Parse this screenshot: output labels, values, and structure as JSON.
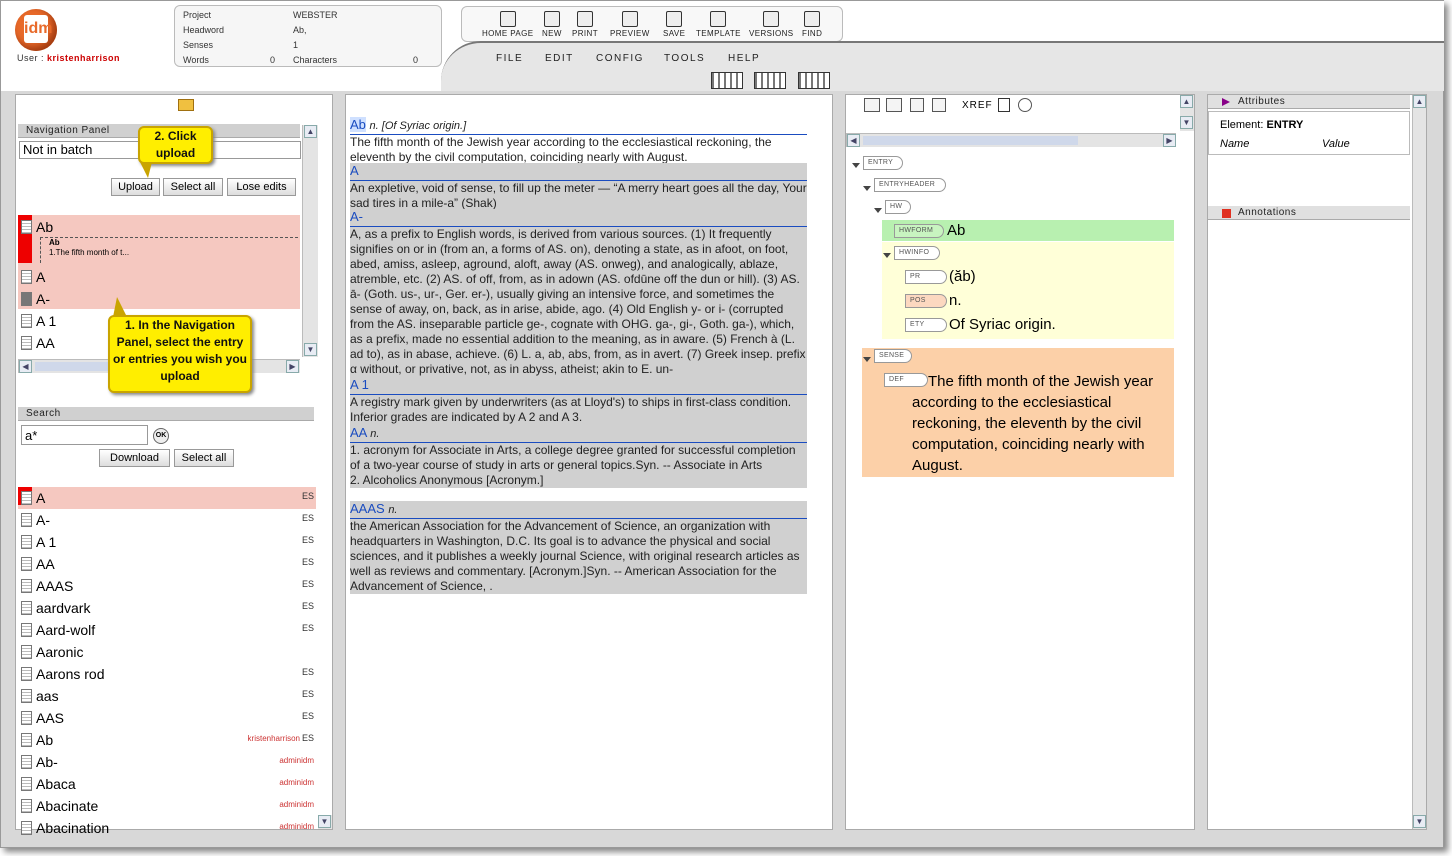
{
  "header": {
    "user_label": "User :",
    "user_name": "kristenharrison",
    "project_label": "Project",
    "project_value": "WEBSTER",
    "headword_label": "Headword",
    "headword_value": "Ab,",
    "senses_label": "Senses",
    "senses_value": "1",
    "words_label": "Words",
    "words_value": "0",
    "characters_label": "Characters",
    "characters_value": "0"
  },
  "toolbar": [
    "HOME PAGE",
    "NEW",
    "PRINT",
    "PREVIEW",
    "SAVE",
    "TEMPLATE",
    "VERSIONS",
    "FIND"
  ],
  "menu": [
    "FILE",
    "EDIT",
    "CONFIG",
    "TOOLS",
    "HELP"
  ],
  "nav": {
    "title": "Navigation Panel",
    "batch_value": "Not in batch",
    "upload": "Upload",
    "select_all": "Select all",
    "lose_edits": "Lose edits",
    "items": [
      "Ab",
      "A",
      "A-",
      "A 1",
      "AA"
    ],
    "sub_hw": "Ab",
    "sub_def": "1.The fifth month of t..."
  },
  "callouts": {
    "upload": "2. Click upload",
    "nav": "1. In the Navigation Panel, select the entry or entries you wish you upload"
  },
  "search": {
    "title": "Search",
    "query": "a*",
    "ok": "OK",
    "download": "Download",
    "select_all": "Select all",
    "results": [
      {
        "w": "A",
        "es": "ES",
        "who": ""
      },
      {
        "w": "A-",
        "es": "ES",
        "who": ""
      },
      {
        "w": "A 1",
        "es": "ES",
        "who": ""
      },
      {
        "w": "AA",
        "es": "ES",
        "who": ""
      },
      {
        "w": "AAAS",
        "es": "ES",
        "who": ""
      },
      {
        "w": "aardvark",
        "es": "ES",
        "who": ""
      },
      {
        "w": "Aard-wolf",
        "es": "ES",
        "who": ""
      },
      {
        "w": "Aaronic",
        "es": "",
        "who": ""
      },
      {
        "w": "Aarons rod",
        "es": "ES",
        "who": ""
      },
      {
        "w": "aas",
        "es": "ES",
        "who": ""
      },
      {
        "w": "AAS",
        "es": "ES",
        "who": ""
      },
      {
        "w": "Ab",
        "es": "ES",
        "who": "kristenharrison"
      },
      {
        "w": "Ab-",
        "es": "",
        "who": "adminidm"
      },
      {
        "w": "Abaca",
        "es": "",
        "who": "adminidm"
      },
      {
        "w": "Abacinate",
        "es": "",
        "who": "adminidm"
      },
      {
        "w": "Abacination",
        "es": "",
        "who": "adminidm"
      }
    ]
  },
  "entries": [
    {
      "hw": "Ab",
      "meta": "n. [Of Syriac origin.]",
      "body": "The fifth month of the Jewish year according to the ecclesiastical reckoning, the eleventh by the civil computation, coinciding nearly with August."
    },
    {
      "hw": "A",
      "meta": "",
      "body": "An expletive, void of sense, to fill up the meter — “A merry heart goes all the day, Your sad tires in a mile-a” (Shak)"
    },
    {
      "hw": "A-",
      "meta": "",
      "body": "A, as a prefix to English words, is derived from various sources. (1) It frequently signifies on or in (from an, a forms of AS. on), denoting a state, as in afoot, on foot, abed, amiss, asleep, aground, aloft, away (AS. onweg), and analogically, ablaze, atremble, etc. (2) AS. of off, from, as in adown (AS. ofdūne off the dun or hill). (3) AS. ā- (Goth. us-, ur-, Ger. er-), usually giving an intensive force, and sometimes the sense of away, on, back, as in arise, abide, ago. (4) Old English y- or i- (corrupted from the AS. inseparable particle ge-, cognate with OHG. ga-, gi-, Goth. ga-), which, as a prefix, made no essential addition to the meaning, as in aware. (5) French à (L. ad to), as in abase, achieve. (6) L. a, ab, abs, from, as in avert. (7) Greek insep. prefix α without, or privative, not, as in abyss, atheist; akin to E. un-"
    },
    {
      "hw": "A 1",
      "meta": "",
      "body": "A registry mark given by underwriters (as at Lloyd's) to ships in first-class condition. Inferior grades are indicated by A 2 and A 3."
    },
    {
      "hw": "AA",
      "meta": "n.",
      "body": "1. acronym for Associate in Arts, a college degree granted for successful completion of a two-year course of study in arts or general topics.Syn. -- Associate in Arts\n2. Alcoholics Anonymous [Acronym.]"
    },
    {
      "hw": "AAAS",
      "meta": "n.",
      "body": "the American Association for the Advancement of Science, an organization with headquarters in Washington, D.C. Its goal is to advance the physical and social sciences, and it publishes a weekly journal Science, with original research articles as well as reviews and commentary. [Acronym.]Syn. -- American Association for the Advancement of Science, ."
    }
  ],
  "tree": {
    "xref": "XREF",
    "nodes": {
      "entry": "ENTRY",
      "entryheader": "ENTRYHEADER",
      "hw": "HW",
      "hwform": "HWFORM",
      "hwinfo": "HWINFO",
      "pr": "PR",
      "pos": "POS",
      "ety": "ETY",
      "sense": "SENSE",
      "def": "DEF"
    },
    "values": {
      "hwform": "Ab",
      "pr": "(ăb)",
      "pos": "n.",
      "ety": "Of Syriac origin.",
      "def": "The fifth month of the Jewish year according to the ecclesiastical reckoning, the eleventh by the civil computation, coinciding nearly with August."
    }
  },
  "attributes": {
    "title": "Attributes",
    "element_label": "Element:",
    "element_value": "ENTRY",
    "col_name": "Name",
    "col_value": "Value",
    "annotations_title": "Annotations"
  },
  "colors": {
    "accent": "#1a4cc0",
    "selected": "#f5c8c0",
    "hwform": "#b8f0b0",
    "hwinfo": "#ffffd8",
    "sense": "#fcd0a8",
    "callout": "#ffee00"
  }
}
